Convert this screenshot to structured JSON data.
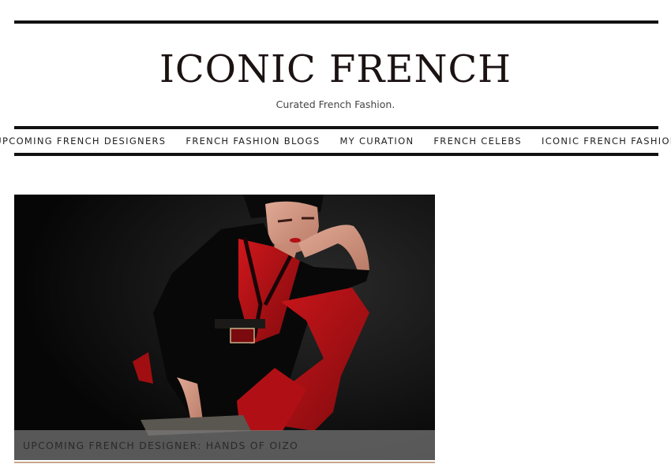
{
  "header": {
    "title": "ICONIC FRENCH",
    "tagline": "Curated French Fashion."
  },
  "nav": {
    "items": [
      {
        "label": "UPCOMING FRENCH DESIGNERS"
      },
      {
        "label": "FRENCH FASHION BLOGS"
      },
      {
        "label": "MY CURATION"
      },
      {
        "label": "FRENCH CELEBS"
      },
      {
        "label": "ICONIC FRENCH FASHION"
      }
    ]
  },
  "featured_post": {
    "caption": "UPCOMING FRENCH DESIGNER: HANDS OF OIZO",
    "image_alt": "model-in-red-and-black-harness-outfit"
  },
  "colors": {
    "rule": "#111111",
    "title": "#1b1212",
    "accent_underline": "#caa58a",
    "caption_overlay": "#787878"
  }
}
